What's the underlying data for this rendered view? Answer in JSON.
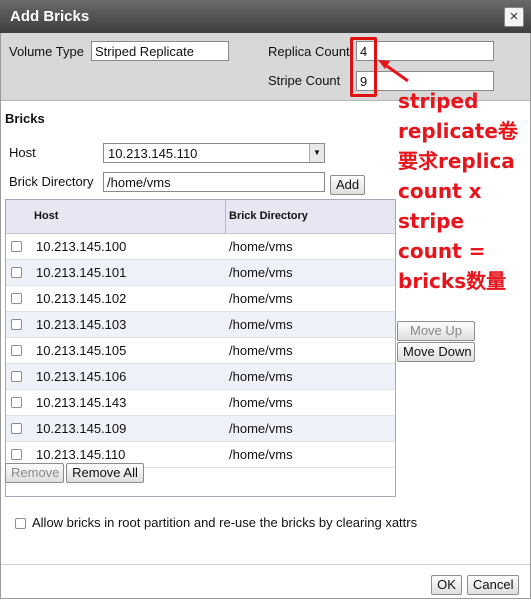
{
  "dialog": {
    "title": "Add Bricks",
    "close_glyph": "×"
  },
  "volume": {
    "type_label": "Volume Type",
    "type_value": "Striped Replicate",
    "replica_label": "Replica Count",
    "replica_value": "4",
    "stripe_label": "Stripe Count",
    "stripe_value": "9"
  },
  "bricks": {
    "section_title": "Bricks",
    "host_label": "Host",
    "host_selected": "10.213.145.110",
    "dir_label": "Brick Directory",
    "dir_value": "/home/vms",
    "add_label": "Add",
    "columns": [
      "Host",
      "Brick Directory"
    ],
    "rows": [
      {
        "host": "10.213.145.100",
        "dir": "/home/vms"
      },
      {
        "host": "10.213.145.101",
        "dir": "/home/vms"
      },
      {
        "host": "10.213.145.102",
        "dir": "/home/vms"
      },
      {
        "host": "10.213.145.103",
        "dir": "/home/vms"
      },
      {
        "host": "10.213.145.105",
        "dir": "/home/vms"
      },
      {
        "host": "10.213.145.106",
        "dir": "/home/vms"
      },
      {
        "host": "10.213.145.143",
        "dir": "/home/vms"
      },
      {
        "host": "10.213.145.109",
        "dir": "/home/vms"
      },
      {
        "host": "10.213.145.110",
        "dir": "/home/vms"
      }
    ],
    "move_up_label": "Move Up",
    "move_down_label": "Move Down",
    "remove_label": "Remove",
    "remove_all_label": "Remove All"
  },
  "options": {
    "allow_root_label": "Allow bricks in root partition and re-use the bricks by clearing xattrs"
  },
  "footer": {
    "ok_label": "OK",
    "cancel_label": "Cancel"
  },
  "annotation": {
    "text": "striped replicate卷要求replica count x stripe count = bricks数量",
    "color": "#e8141c"
  }
}
